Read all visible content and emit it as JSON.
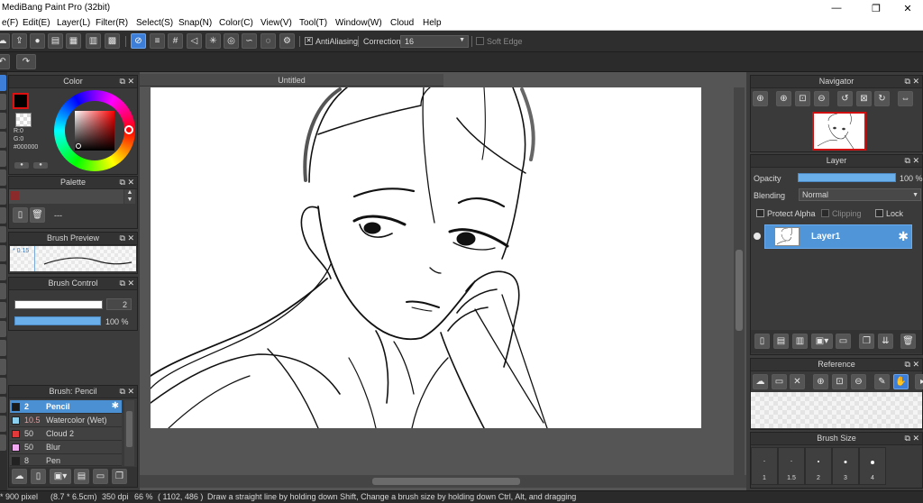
{
  "window": {
    "title": "MediBang Paint Pro (32bit)",
    "controls": {
      "minimize": "—",
      "maximize": "❐",
      "close": "✕"
    }
  },
  "menu": [
    "e(F)",
    "Edit(E)",
    "Layer(L)",
    "Filter(R)",
    "Select(S)",
    "Snap(N)",
    "Color(C)",
    "View(V)",
    "Tool(T)",
    "Window(W)",
    "Cloud",
    "Help"
  ],
  "toolbar": {
    "antialiasing_label": "AntiAliasing",
    "antialiasing_checked": true,
    "correction_label": "Correction",
    "correction_value": "16",
    "soft_edge_label": "Soft Edge",
    "soft_edge_checked": false
  },
  "color_panel": {
    "title": "Color",
    "r_text": "R:0",
    "g_text": "G:0",
    "hex_text": "#000000",
    "fg_color": "#000000",
    "border_color": "#e01010"
  },
  "palette_panel": {
    "title": "Palette",
    "dash": "---"
  },
  "brush_preview_panel": {
    "title": "Brush Preview",
    "size_text": "* 0.15"
  },
  "brush_control_panel": {
    "title": "Brush Control",
    "size_value": "2",
    "opacity_value": "100 %"
  },
  "brush_panel": {
    "title": "Brush: Pencil",
    "brushes": [
      {
        "size": "2",
        "name": "Pencil",
        "color": "#1a1a1a",
        "selected": true
      },
      {
        "size": "10.5",
        "name": "Watercolor (Wet)",
        "color": "#8cd0f0",
        "selected": false
      },
      {
        "size": "50",
        "name": "Cloud 2",
        "color": "#e23a3a",
        "selected": false
      },
      {
        "size": "50",
        "name": "Blur",
        "color": "#f0a8f0",
        "selected": false
      },
      {
        "size": "8",
        "name": "Pen",
        "color": "#222222",
        "selected": false
      }
    ]
  },
  "document": {
    "tab_title": "Untitled"
  },
  "navigator_panel": {
    "title": "Navigator"
  },
  "layer_panel": {
    "title": "Layer",
    "opacity_label": "Opacity",
    "opacity_value": "100 %",
    "blending_label": "Blending",
    "blending_value": "Normal",
    "protect_alpha_label": "Protect Alpha",
    "clipping_label": "Clipping",
    "lock_label": "Lock",
    "layers": [
      {
        "name": "Layer1",
        "visible": true,
        "selected": true
      }
    ]
  },
  "reference_panel": {
    "title": "Reference"
  },
  "brush_size_panel": {
    "title": "Brush Size",
    "sizes": [
      "1",
      "1.5",
      "2",
      "3",
      "4"
    ]
  },
  "status": {
    "dimensions": "* 900 pixel",
    "physical": "(8.7 * 6.5cm)",
    "dpi": "350 dpi",
    "zoom": "66 %",
    "coords": "( 1102, 486 )",
    "hint": "Draw a straight line by holding down Shift, Change a brush size by holding down Ctrl, Alt, and dragging"
  },
  "accent_color": "#4c90d4"
}
